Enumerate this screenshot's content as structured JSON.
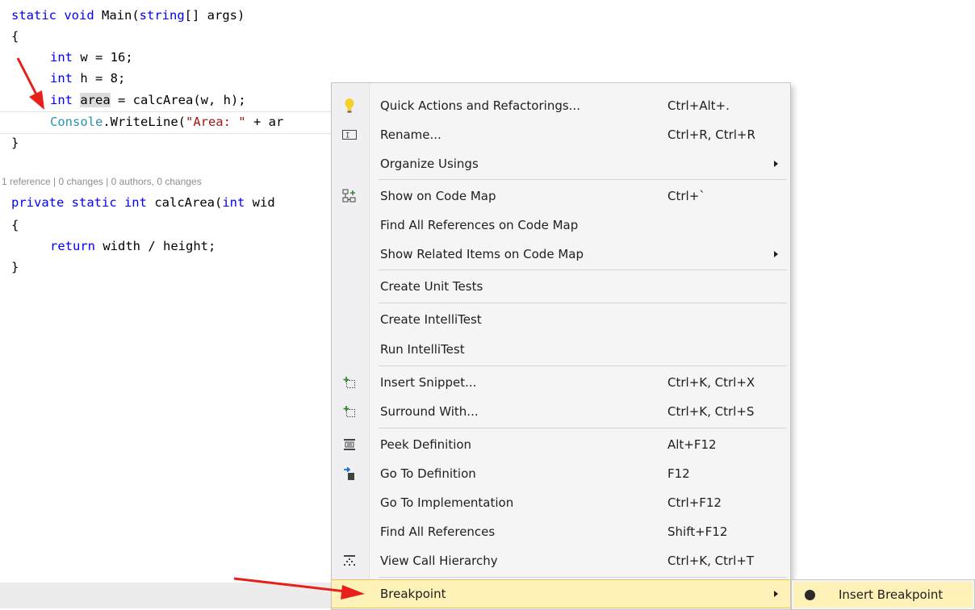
{
  "editor": {
    "lines": [
      {
        "a": "static void Main(",
        "b": "string",
        "c": "[] args)"
      },
      {
        "text": "{"
      },
      {
        "kw": "int",
        "rest": " w = 16;"
      },
      {
        "kw": "int",
        "rest": " h = 8;"
      },
      {
        "kw": "int",
        "hl": "area",
        "rest": " = calcArea(w, h);"
      },
      {
        "ty": "Console",
        "mid": ".WriteLine(",
        "str": "\"Area: \"",
        "rest": " + ar"
      },
      {
        "text": "}"
      },
      {
        "a": "private static int calcArea(",
        "b": "int",
        "c": " wid"
      },
      {
        "text": "{"
      },
      {
        "kw": "return",
        "rest": " width / height;"
      },
      {
        "text": "}"
      }
    ],
    "codelens": "1 reference | 0 changes | 0 authors, 0 changes"
  },
  "context_menu": {
    "items": [
      {
        "label": "Quick Actions and Refactorings...",
        "shortcut": "Ctrl+Alt+.",
        "icon": "lightbulb-icon"
      },
      {
        "label": "Rename...",
        "shortcut": "Ctrl+R, Ctrl+R",
        "icon": "rename-icon"
      },
      {
        "label": "Organize Usings",
        "shortcut": "",
        "submenu": true
      },
      {
        "label": "Show on Code Map",
        "shortcut": "Ctrl+`",
        "icon": "code-map-icon"
      },
      {
        "label": "Find All References on Code Map",
        "shortcut": ""
      },
      {
        "label": "Show Related Items on Code Map",
        "shortcut": "",
        "submenu": true
      },
      {
        "label": "Create Unit Tests",
        "shortcut": ""
      },
      {
        "label": "Create IntelliTest",
        "shortcut": ""
      },
      {
        "label": "Run IntelliTest",
        "shortcut": ""
      },
      {
        "label": "Insert Snippet...",
        "shortcut": "Ctrl+K, Ctrl+X",
        "icon": "insert-snippet-icon"
      },
      {
        "label": "Surround With...",
        "shortcut": "Ctrl+K, Ctrl+S",
        "icon": "surround-with-icon"
      },
      {
        "label": "Peek Definition",
        "shortcut": "Alt+F12",
        "icon": "peek-definition-icon"
      },
      {
        "label": "Go To Definition",
        "shortcut": "F12",
        "icon": "go-to-definition-icon"
      },
      {
        "label": "Go To Implementation",
        "shortcut": "Ctrl+F12"
      },
      {
        "label": "Find All References",
        "shortcut": "Shift+F12"
      },
      {
        "label": "View Call Hierarchy",
        "shortcut": "Ctrl+K, Ctrl+T",
        "icon": "call-hierarchy-icon"
      },
      {
        "label": "Breakpoint",
        "shortcut": "",
        "submenu": true,
        "selected": true
      }
    ]
  },
  "submenu": {
    "label": "Insert Breakpoint",
    "icon": "breakpoint-dot-icon"
  },
  "colors": {
    "keyword": "#0000ff",
    "type": "#2b91af",
    "string": "#a31515",
    "highlight": "#fff2b8",
    "annotation_arrow": "#e8201a"
  }
}
